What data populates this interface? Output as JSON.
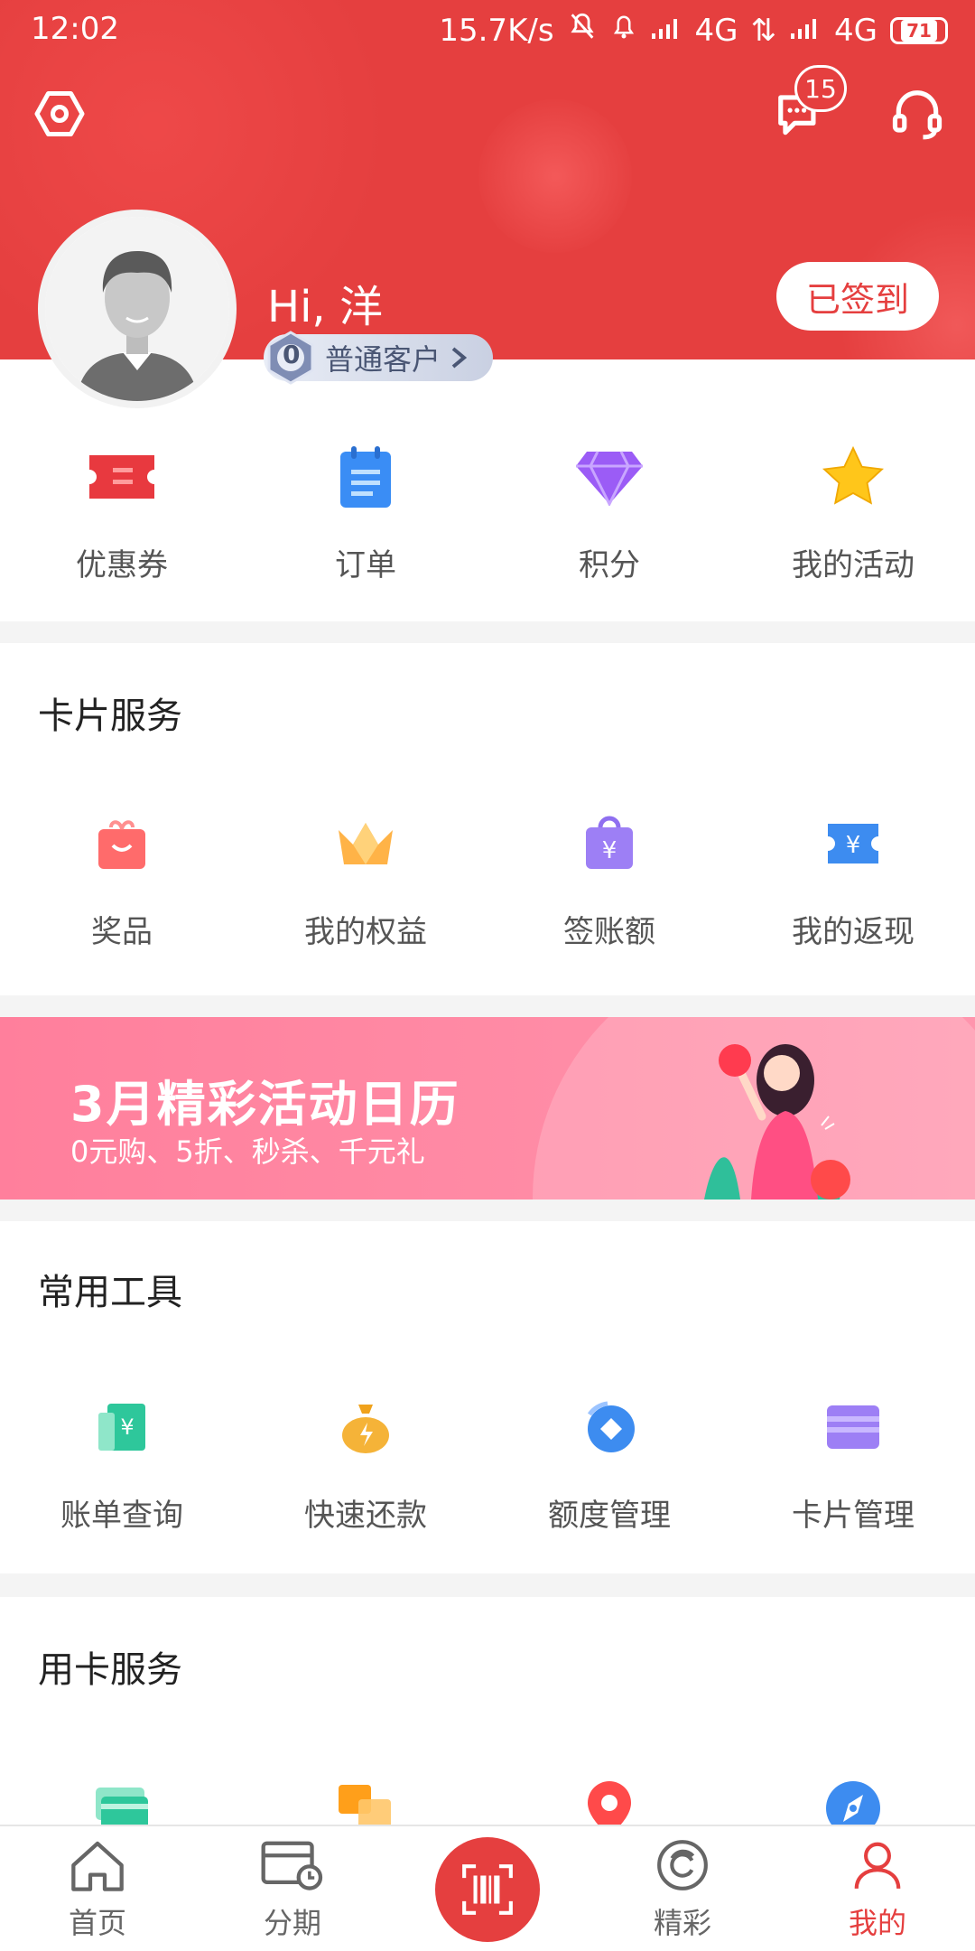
{
  "status_bar": {
    "time": "12:02",
    "speed": "15.7K/s",
    "net1": "4G",
    "net2": "4G",
    "battery": "71"
  },
  "header": {
    "message_badge": "15",
    "greeting": "Hi, 洋",
    "level_number": "0",
    "level_label": "普通客户",
    "signin_label": "已签到",
    "bg_color": "#e53f3f"
  },
  "quick_actions": [
    {
      "label": "优惠券",
      "icon": "coupon-icon"
    },
    {
      "label": "订单",
      "icon": "order-icon"
    },
    {
      "label": "积分",
      "icon": "diamond-icon"
    },
    {
      "label": "我的活动",
      "icon": "star-icon"
    }
  ],
  "card_services": {
    "title": "卡片服务",
    "items": [
      {
        "label": "奖品",
        "icon": "gift-icon"
      },
      {
        "label": "我的权益",
        "icon": "crown-icon"
      },
      {
        "label": "签账额",
        "icon": "bag-yen-icon"
      },
      {
        "label": "我的返现",
        "icon": "ticket-yen-icon"
      }
    ]
  },
  "banner": {
    "title": "3月精彩活动日历",
    "subtitle": "0元购、5折、秒杀、千元礼"
  },
  "tools": {
    "title": "常用工具",
    "items": [
      {
        "label": "账单查询",
        "icon": "bill-icon"
      },
      {
        "label": "快速还款",
        "icon": "money-bag-icon"
      },
      {
        "label": "额度管理",
        "icon": "limit-icon"
      },
      {
        "label": "卡片管理",
        "icon": "card-wallet-icon"
      }
    ]
  },
  "card_use": {
    "title": "用卡服务",
    "items": [
      {
        "icon": "cards-icon"
      },
      {
        "icon": "squares-icon"
      },
      {
        "icon": "location-icon"
      },
      {
        "icon": "compass-icon"
      }
    ]
  },
  "tabbar": {
    "items": [
      {
        "label": "首页",
        "icon": "home-icon"
      },
      {
        "label": "分期",
        "icon": "installment-icon"
      },
      {
        "label": "",
        "icon": "scan-icon"
      },
      {
        "label": "精彩",
        "icon": "discover-icon"
      },
      {
        "label": "我的",
        "icon": "profile-icon"
      }
    ],
    "active": "我的",
    "active_color": "#e53f3f"
  }
}
